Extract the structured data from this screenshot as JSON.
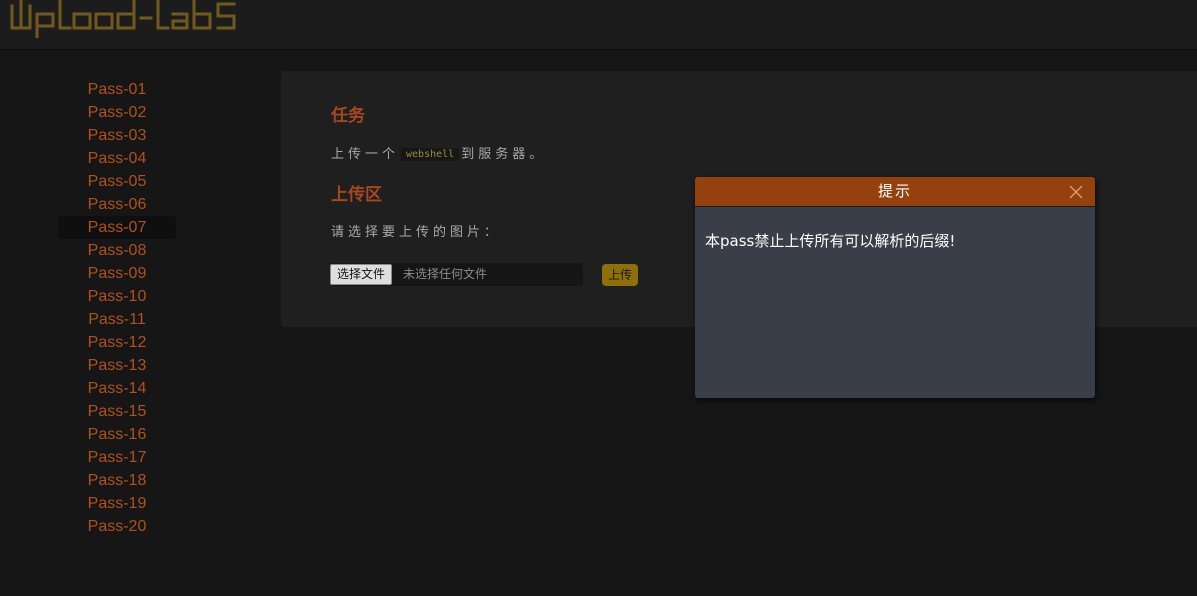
{
  "header": {
    "logo_text": "upload-labs",
    "logo_color": "#6f5a1c"
  },
  "sidebar": {
    "active_index": 6,
    "items": [
      {
        "label": "Pass-01"
      },
      {
        "label": "Pass-02"
      },
      {
        "label": "Pass-03"
      },
      {
        "label": "Pass-04"
      },
      {
        "label": "Pass-05"
      },
      {
        "label": "Pass-06"
      },
      {
        "label": "Pass-07"
      },
      {
        "label": "Pass-08"
      },
      {
        "label": "Pass-09"
      },
      {
        "label": "Pass-10"
      },
      {
        "label": "Pass-11"
      },
      {
        "label": "Pass-12"
      },
      {
        "label": "Pass-13"
      },
      {
        "label": "Pass-14"
      },
      {
        "label": "Pass-15"
      },
      {
        "label": "Pass-16"
      },
      {
        "label": "Pass-17"
      },
      {
        "label": "Pass-18"
      },
      {
        "label": "Pass-19"
      },
      {
        "label": "Pass-20"
      }
    ]
  },
  "task": {
    "title": "任务",
    "text_before": "上传一个",
    "code": "webshell",
    "text_after": "到服务器。"
  },
  "upload": {
    "title": "上传区",
    "prompt": "请选择要上传的图片：",
    "choose_file_label": "选择文件",
    "file_status": "未选择任何文件",
    "submit_label": "上传"
  },
  "dialog": {
    "title": "提示",
    "message": "本pass禁止上传所有可以解析的后缀!",
    "close_icon": "close-icon"
  },
  "colors": {
    "accent": "#a8471e",
    "dialog_header": "#95410e",
    "upload_button": "#8e6f08"
  }
}
